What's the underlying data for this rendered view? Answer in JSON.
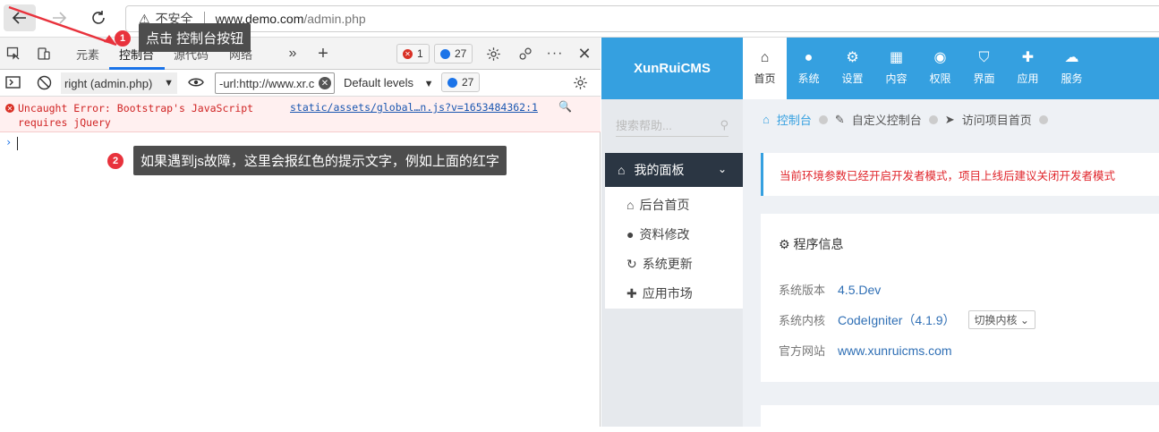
{
  "browser": {
    "insecure_label": "不安全",
    "url_host": "www.demo.com",
    "url_path": "/admin.php"
  },
  "devtools": {
    "tabs": [
      "元素",
      "控制台",
      "源代码",
      "网络"
    ],
    "active_tab": "控制台",
    "error_count": "1",
    "message_count": "27",
    "context": "right (admin.php)",
    "filter_value": "-url:http://www.xr.c",
    "levels": "Default levels",
    "toolbar_message_count": "27",
    "error_text": "Uncaught Error: Bootstrap's JavaScript requires jQuery",
    "error_source": "static/assets/global…n.js?v=1653484362:1",
    "prompt": "›"
  },
  "annotations": {
    "callout1_num": "1",
    "callout1_text": "点击 控制台按钮",
    "callout2_num": "2",
    "callout2_text": "如果遇到js故障，这里会报红色的提示文字，例如上面的红字"
  },
  "cms": {
    "logo": "XunRuiCMS",
    "nav": [
      {
        "label": "首页",
        "icon": "home-icon"
      },
      {
        "label": "系统",
        "icon": "globe-icon"
      },
      {
        "label": "设置",
        "icon": "cogs-icon"
      },
      {
        "label": "内容",
        "icon": "grid-icon"
      },
      {
        "label": "权限",
        "icon": "user-icon"
      },
      {
        "label": "界面",
        "icon": "html5-icon"
      },
      {
        "label": "应用",
        "icon": "puzzle-icon"
      },
      {
        "label": "服务",
        "icon": "cloud-icon"
      }
    ],
    "search_placeholder": "搜索帮助...",
    "side_head": "我的面板",
    "side_items": [
      "后台首页",
      "资料修改",
      "系统更新",
      "应用市场"
    ],
    "breadcrumbs": [
      "控制台",
      "自定义控制台",
      "访问项目首页"
    ],
    "alert": "当前环境参数已经开启开发者模式，项目上线后建议关闭开发者模式",
    "info_title": "程序信息",
    "version_label": "系统版本",
    "version_value": "4.5.Dev",
    "kernel_label": "系统内核",
    "kernel_value": "CodeIgniter（4.1.9）",
    "kernel_button": "切换内核",
    "site_label": "官方网站",
    "site_value": "www.xunruicms.com"
  },
  "colors": {
    "cms_blue": "#35a0e0",
    "error_red": "#d93025",
    "callout_gray": "#4d4d4d",
    "badge_red": "#e8323c"
  }
}
